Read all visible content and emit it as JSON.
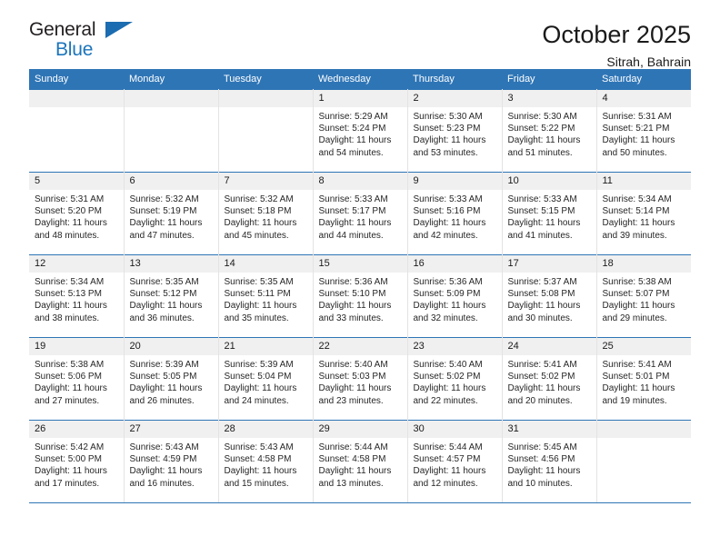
{
  "logo": {
    "text_top": "General",
    "text_bottom": "Blue",
    "triangle_color": "#1b6cb0",
    "blue_color": "#1b75bb"
  },
  "header": {
    "title": "October 2025",
    "subtitle": "Sitrah, Bahrain"
  },
  "colors": {
    "header_blue": "#2e75b6",
    "daynum_bg": "#f0f0f0",
    "grid_line": "#e3e3e3"
  },
  "weekdays": [
    "Sunday",
    "Monday",
    "Tuesday",
    "Wednesday",
    "Thursday",
    "Friday",
    "Saturday"
  ],
  "weeks": [
    [
      {
        "day": "",
        "lines": []
      },
      {
        "day": "",
        "lines": []
      },
      {
        "day": "",
        "lines": []
      },
      {
        "day": "1",
        "lines": [
          "Sunrise: 5:29 AM",
          "Sunset: 5:24 PM",
          "Daylight: 11 hours",
          "and 54 minutes."
        ]
      },
      {
        "day": "2",
        "lines": [
          "Sunrise: 5:30 AM",
          "Sunset: 5:23 PM",
          "Daylight: 11 hours",
          "and 53 minutes."
        ]
      },
      {
        "day": "3",
        "lines": [
          "Sunrise: 5:30 AM",
          "Sunset: 5:22 PM",
          "Daylight: 11 hours",
          "and 51 minutes."
        ]
      },
      {
        "day": "4",
        "lines": [
          "Sunrise: 5:31 AM",
          "Sunset: 5:21 PM",
          "Daylight: 11 hours",
          "and 50 minutes."
        ]
      }
    ],
    [
      {
        "day": "5",
        "lines": [
          "Sunrise: 5:31 AM",
          "Sunset: 5:20 PM",
          "Daylight: 11 hours",
          "and 48 minutes."
        ]
      },
      {
        "day": "6",
        "lines": [
          "Sunrise: 5:32 AM",
          "Sunset: 5:19 PM",
          "Daylight: 11 hours",
          "and 47 minutes."
        ]
      },
      {
        "day": "7",
        "lines": [
          "Sunrise: 5:32 AM",
          "Sunset: 5:18 PM",
          "Daylight: 11 hours",
          "and 45 minutes."
        ]
      },
      {
        "day": "8",
        "lines": [
          "Sunrise: 5:33 AM",
          "Sunset: 5:17 PM",
          "Daylight: 11 hours",
          "and 44 minutes."
        ]
      },
      {
        "day": "9",
        "lines": [
          "Sunrise: 5:33 AM",
          "Sunset: 5:16 PM",
          "Daylight: 11 hours",
          "and 42 minutes."
        ]
      },
      {
        "day": "10",
        "lines": [
          "Sunrise: 5:33 AM",
          "Sunset: 5:15 PM",
          "Daylight: 11 hours",
          "and 41 minutes."
        ]
      },
      {
        "day": "11",
        "lines": [
          "Sunrise: 5:34 AM",
          "Sunset: 5:14 PM",
          "Daylight: 11 hours",
          "and 39 minutes."
        ]
      }
    ],
    [
      {
        "day": "12",
        "lines": [
          "Sunrise: 5:34 AM",
          "Sunset: 5:13 PM",
          "Daylight: 11 hours",
          "and 38 minutes."
        ]
      },
      {
        "day": "13",
        "lines": [
          "Sunrise: 5:35 AM",
          "Sunset: 5:12 PM",
          "Daylight: 11 hours",
          "and 36 minutes."
        ]
      },
      {
        "day": "14",
        "lines": [
          "Sunrise: 5:35 AM",
          "Sunset: 5:11 PM",
          "Daylight: 11 hours",
          "and 35 minutes."
        ]
      },
      {
        "day": "15",
        "lines": [
          "Sunrise: 5:36 AM",
          "Sunset: 5:10 PM",
          "Daylight: 11 hours",
          "and 33 minutes."
        ]
      },
      {
        "day": "16",
        "lines": [
          "Sunrise: 5:36 AM",
          "Sunset: 5:09 PM",
          "Daylight: 11 hours",
          "and 32 minutes."
        ]
      },
      {
        "day": "17",
        "lines": [
          "Sunrise: 5:37 AM",
          "Sunset: 5:08 PM",
          "Daylight: 11 hours",
          "and 30 minutes."
        ]
      },
      {
        "day": "18",
        "lines": [
          "Sunrise: 5:38 AM",
          "Sunset: 5:07 PM",
          "Daylight: 11 hours",
          "and 29 minutes."
        ]
      }
    ],
    [
      {
        "day": "19",
        "lines": [
          "Sunrise: 5:38 AM",
          "Sunset: 5:06 PM",
          "Daylight: 11 hours",
          "and 27 minutes."
        ]
      },
      {
        "day": "20",
        "lines": [
          "Sunrise: 5:39 AM",
          "Sunset: 5:05 PM",
          "Daylight: 11 hours",
          "and 26 minutes."
        ]
      },
      {
        "day": "21",
        "lines": [
          "Sunrise: 5:39 AM",
          "Sunset: 5:04 PM",
          "Daylight: 11 hours",
          "and 24 minutes."
        ]
      },
      {
        "day": "22",
        "lines": [
          "Sunrise: 5:40 AM",
          "Sunset: 5:03 PM",
          "Daylight: 11 hours",
          "and 23 minutes."
        ]
      },
      {
        "day": "23",
        "lines": [
          "Sunrise: 5:40 AM",
          "Sunset: 5:02 PM",
          "Daylight: 11 hours",
          "and 22 minutes."
        ]
      },
      {
        "day": "24",
        "lines": [
          "Sunrise: 5:41 AM",
          "Sunset: 5:02 PM",
          "Daylight: 11 hours",
          "and 20 minutes."
        ]
      },
      {
        "day": "25",
        "lines": [
          "Sunrise: 5:41 AM",
          "Sunset: 5:01 PM",
          "Daylight: 11 hours",
          "and 19 minutes."
        ]
      }
    ],
    [
      {
        "day": "26",
        "lines": [
          "Sunrise: 5:42 AM",
          "Sunset: 5:00 PM",
          "Daylight: 11 hours",
          "and 17 minutes."
        ]
      },
      {
        "day": "27",
        "lines": [
          "Sunrise: 5:43 AM",
          "Sunset: 4:59 PM",
          "Daylight: 11 hours",
          "and 16 minutes."
        ]
      },
      {
        "day": "28",
        "lines": [
          "Sunrise: 5:43 AM",
          "Sunset: 4:58 PM",
          "Daylight: 11 hours",
          "and 15 minutes."
        ]
      },
      {
        "day": "29",
        "lines": [
          "Sunrise: 5:44 AM",
          "Sunset: 4:58 PM",
          "Daylight: 11 hours",
          "and 13 minutes."
        ]
      },
      {
        "day": "30",
        "lines": [
          "Sunrise: 5:44 AM",
          "Sunset: 4:57 PM",
          "Daylight: 11 hours",
          "and 12 minutes."
        ]
      },
      {
        "day": "31",
        "lines": [
          "Sunrise: 5:45 AM",
          "Sunset: 4:56 PM",
          "Daylight: 11 hours",
          "and 10 minutes."
        ]
      },
      {
        "day": "",
        "lines": []
      }
    ]
  ]
}
